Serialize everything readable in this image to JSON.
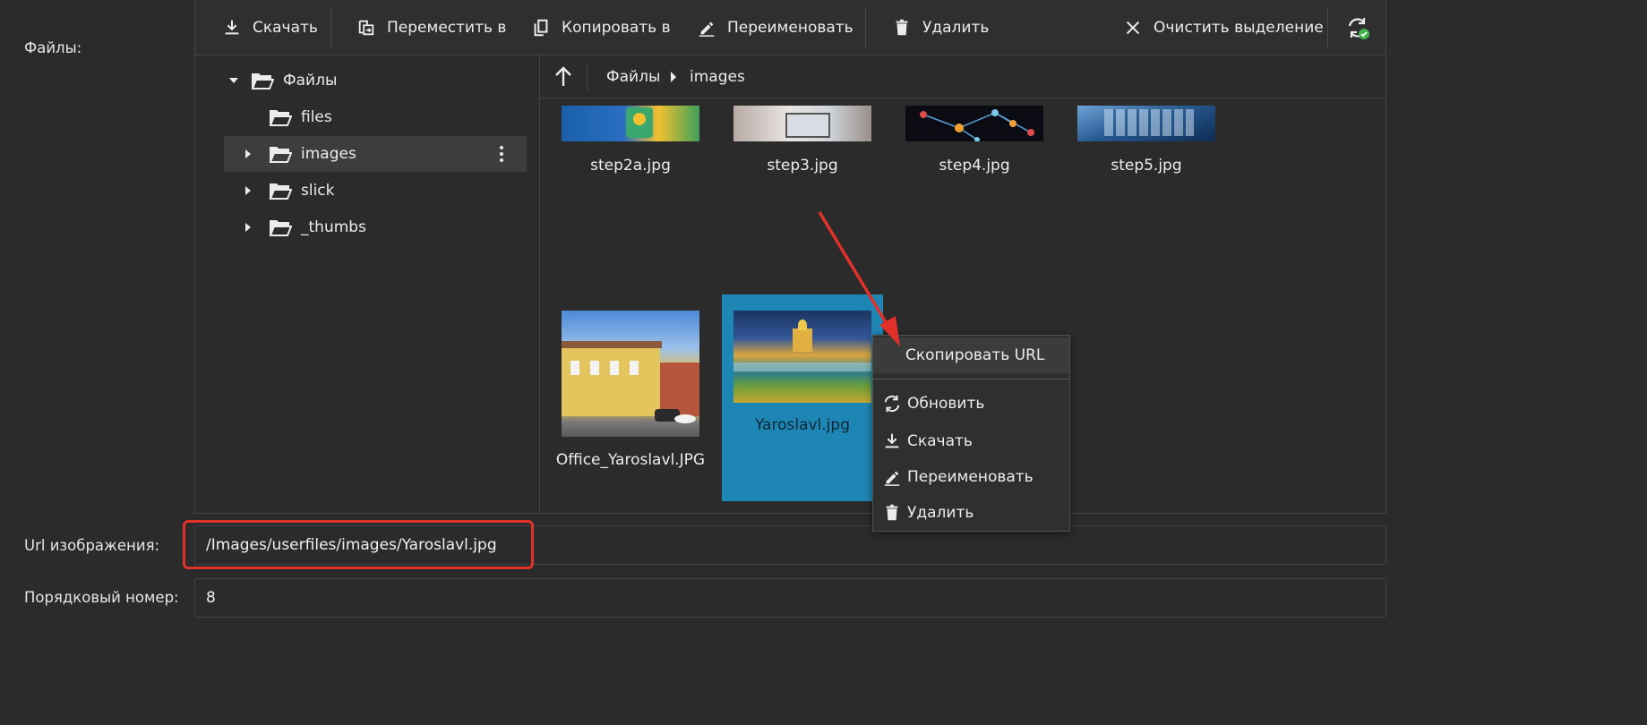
{
  "labels": {
    "files": "Файлы:",
    "image_url": "Url изображения:",
    "order_number": "Порядковый номер:"
  },
  "toolbar": {
    "download": "Скачать",
    "move_to": "Переместить в",
    "copy_to": "Копировать в",
    "rename": "Переименовать",
    "delete": "Удалить",
    "clear_selection": "Очистить выделение"
  },
  "tree": {
    "items": [
      {
        "label": "Файлы",
        "expanded": true
      },
      {
        "label": "files"
      },
      {
        "label": "images",
        "selected": true
      },
      {
        "label": "slick"
      },
      {
        "label": "_thumbs"
      }
    ]
  },
  "breadcrumb": [
    "Файлы",
    "images"
  ],
  "files": [
    {
      "name": "step2a.jpg"
    },
    {
      "name": "step3.jpg"
    },
    {
      "name": "step4.jpg"
    },
    {
      "name": "step5.jpg"
    },
    {
      "name": "Office_Yaroslavl.JPG"
    },
    {
      "name": "Yaroslavl.jpg",
      "selected": true
    }
  ],
  "context_menu": {
    "copy_url": "Скопировать URL",
    "refresh": "Обновить",
    "download": "Скачать",
    "rename": "Переименовать",
    "delete": "Удалить"
  },
  "inputs": {
    "image_url_value": "/Images/userfiles/images/Yaroslavl.jpg",
    "order_number_value": "8"
  },
  "colors": {
    "background": "#2b2b2b",
    "selection": "#1e86b4",
    "highlight_annotation": "#e0302a",
    "refresh_ok_badge": "#3cb44b"
  }
}
